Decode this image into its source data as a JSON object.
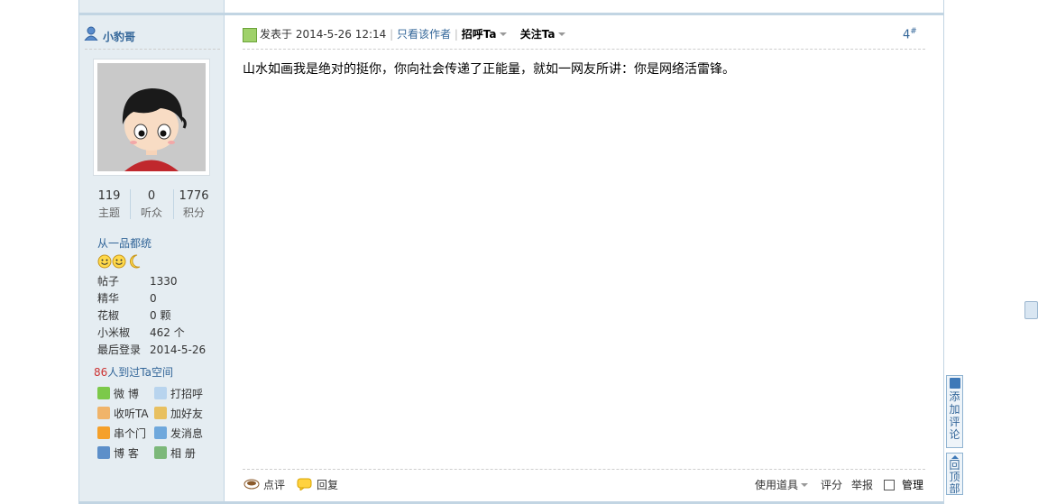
{
  "user": {
    "name": "小豹哥",
    "stats": [
      {
        "value": "119",
        "label": "主题"
      },
      {
        "value": "0",
        "label": "听众"
      },
      {
        "value": "1776",
        "label": "积分"
      }
    ],
    "title": "从一品都统",
    "info": [
      {
        "key": "帖子",
        "value": "1330"
      },
      {
        "key": "精华",
        "value": "0"
      },
      {
        "key": "花椒",
        "value": "0 颗"
      },
      {
        "key": "小米椒",
        "value": "462 个"
      },
      {
        "key": "最后登录",
        "value": "2014-5-26"
      }
    ],
    "visit_count": "86",
    "visit_text": "人到过Ta空间",
    "actions": {
      "weibo": "微 博",
      "greet": "打招呼",
      "follow": "收听TA",
      "add_friend": "加好友",
      "visit": "串个门",
      "message": "发消息",
      "blog": "博 客",
      "album": "相 册"
    }
  },
  "post": {
    "posted_on": "发表于 2014-5-26 12:14",
    "only_author": "只看该作者",
    "greet_ta": "招呼Ta",
    "follow_ta": "关注Ta",
    "floor": "4",
    "floor_sup": "#",
    "body": "山水如画我是绝对的挺你，你向社会传递了正能量，就如一网友所讲：你是网络活雷锋。"
  },
  "footer": {
    "comment": "点评",
    "reply": "回复",
    "tools": "使用道具",
    "rate": "评分",
    "report": "举报",
    "manage": "管理"
  },
  "floating": {
    "add_comment": [
      "添",
      "加",
      "评",
      "论"
    ],
    "back_top": [
      "回",
      "顶",
      "部"
    ]
  },
  "colors": {
    "link": "#336699",
    "sidebar_bg": "#e5edf2",
    "border": "#c2d5e3"
  }
}
